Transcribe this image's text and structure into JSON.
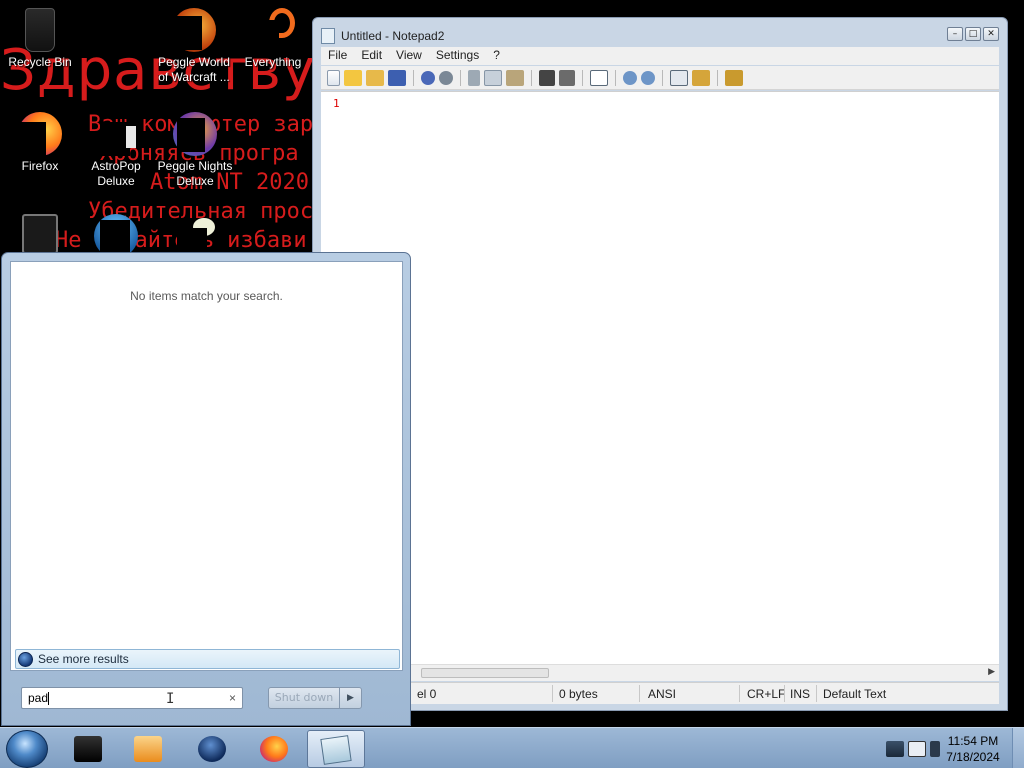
{
  "wallpaper": {
    "lines": [
      "Здравствуй",
      "Ваш компьютер зар",
      "Хроняясь програ",
      "Atom NT 2020",
      "Убедительная прос",
      "Не пытайтесь избави"
    ]
  },
  "desktop_icons": [
    {
      "label": "Recycle Bin",
      "icon": "recycle-bin-icon"
    },
    {
      "label": "Peggle World of Warcraft ...",
      "icon": "peggle-wow-icon"
    },
    {
      "label": "Everything",
      "icon": "everything-search-icon"
    },
    {
      "label": "Firefox",
      "icon": "firefox-icon"
    },
    {
      "label": "AstroPop Deluxe",
      "icon": "astropop-icon"
    },
    {
      "label": "Peggle Nights Deluxe",
      "icon": "peggle-nights-icon"
    }
  ],
  "notepad": {
    "title": "Untitled - Notepad2",
    "menu": [
      "File",
      "Edit",
      "View",
      "Settings",
      "?"
    ],
    "line_number": "1",
    "status": {
      "position": "el 0",
      "size": "0 bytes",
      "encoding": "ANSI",
      "line_endings": "CR+LF",
      "mode": "INS",
      "lexer": "Default Text"
    }
  },
  "start_menu": {
    "no_items": "No items match your search.",
    "see_more": "See more results",
    "search_value": "pad",
    "clear_icon": "×",
    "shutdown_label": "Shut down",
    "shutdown_arrow": "▶"
  },
  "taskbar": {
    "apps": [
      "media-center-icon",
      "media-player-icon",
      "globe-app-icon",
      "firefox-icon",
      "notepad2-icon"
    ],
    "time": "11:54 PM",
    "date": "7/18/2024"
  }
}
